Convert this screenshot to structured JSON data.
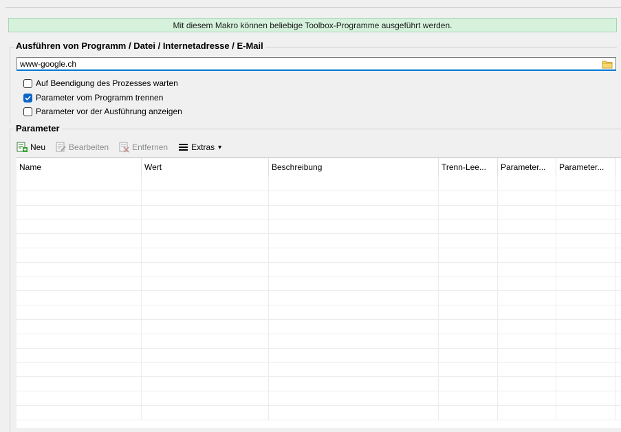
{
  "banner": {
    "text": "Mit diesem Makro können beliebige Toolbox-Programme ausgeführt werden."
  },
  "execute_group": {
    "title": "Ausführen von Programm / Datei / Internetadresse / E-Mail",
    "path_value": "www-google.ch",
    "browse_icon": "folder-icon"
  },
  "options": [
    {
      "label": "Auf Beendigung des Prozesses warten",
      "checked": false
    },
    {
      "label": "Parameter vom Programm trennen",
      "checked": true
    },
    {
      "label": "Parameter vor der Ausführung anzeigen",
      "checked": false
    }
  ],
  "parameter_group": {
    "title": "Parameter"
  },
  "toolbar": {
    "new_label": "Neu",
    "edit_label": "Bearbeiten",
    "remove_label": "Entfernen",
    "extras_label": "Extras",
    "extras_arrow": "▾"
  },
  "table": {
    "columns": [
      "Name",
      "Wert",
      "Beschreibung",
      "Trenn-Lee...",
      "Parameter...",
      "Parameter..."
    ],
    "rows": []
  },
  "colors": {
    "banner_bg": "#d6f2dd",
    "accent": "#0078d7",
    "checkbox_checked": "#0a64c8"
  }
}
